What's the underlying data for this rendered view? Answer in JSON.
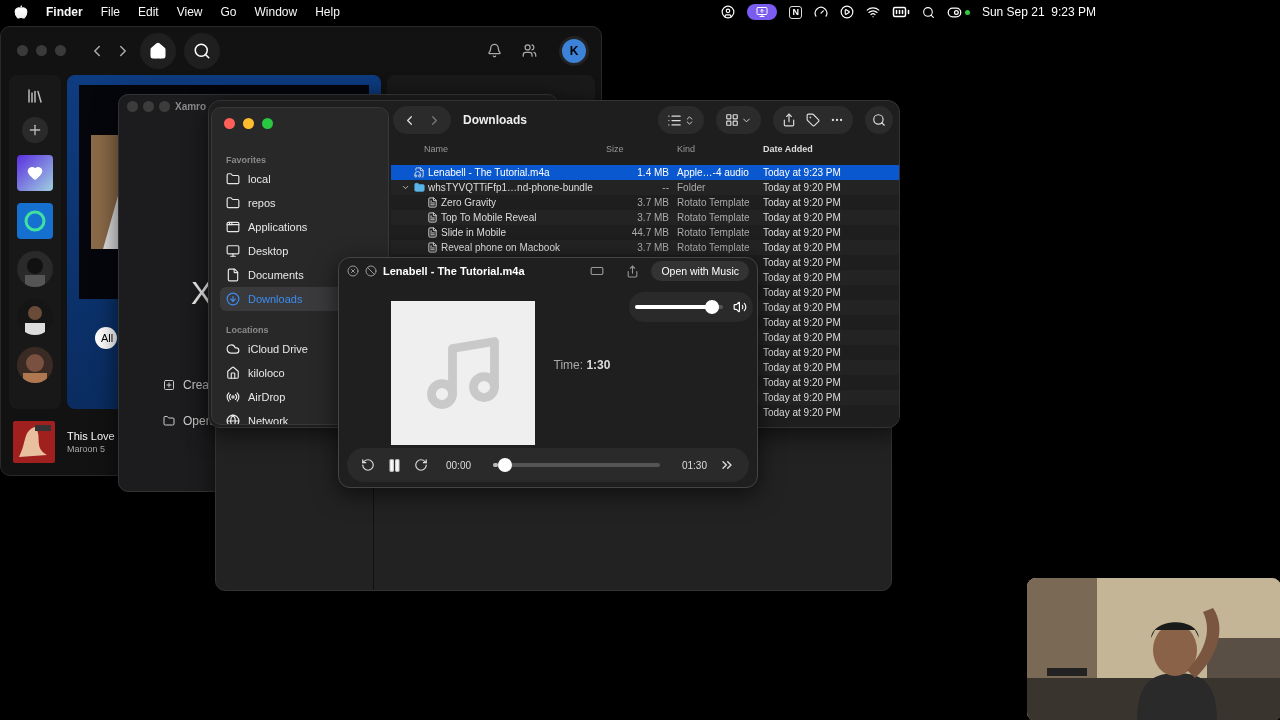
{
  "menu_bar": {
    "app": "Finder",
    "menus": [
      "File",
      "Edit",
      "View",
      "Go",
      "Window",
      "Help"
    ],
    "status_badge": "N",
    "clock": "Sun Sep 21  9:23 PM"
  },
  "music_app": {
    "avatar": "K",
    "filter_chip": "All",
    "now_playing": {
      "title": "This Love",
      "artist": "Maroon 5"
    }
  },
  "xamrock_window": {
    "title": "Xamro",
    "logo_letter": "X",
    "actions": [
      {
        "kind": "create",
        "label": "Crea"
      },
      {
        "kind": "open",
        "label": "Open"
      }
    ]
  },
  "finder": {
    "title": "Downloads",
    "sidebar": [
      {
        "heading": "Favorites",
        "items": [
          {
            "kind": "folder",
            "label": "local",
            "selected": false
          },
          {
            "kind": "folder",
            "label": "repos",
            "selected": false
          },
          {
            "kind": "apps",
            "label": "Applications",
            "selected": false
          },
          {
            "kind": "desktop",
            "label": "Desktop",
            "selected": false
          },
          {
            "kind": "document",
            "label": "Documents",
            "selected": false
          },
          {
            "kind": "download",
            "label": "Downloads",
            "selected": true
          }
        ]
      },
      {
        "heading": "Locations",
        "items": [
          {
            "kind": "cloud",
            "label": "iCloud Drive",
            "selected": false
          },
          {
            "kind": "home",
            "label": "kiloloco",
            "selected": false
          },
          {
            "kind": "airdrop",
            "label": "AirDrop",
            "selected": false
          },
          {
            "kind": "network",
            "label": "Network",
            "selected": false
          }
        ]
      }
    ],
    "columns": [
      {
        "label": "Name",
        "sorted": false
      },
      {
        "label": "Size",
        "sorted": false
      },
      {
        "label": "Kind",
        "sorted": false
      },
      {
        "label": "Date Added",
        "sorted": true
      }
    ],
    "rows": [
      {
        "kind": "audio",
        "name": "Lenabell - The Tutorial.m4a",
        "size": "1.4 MB",
        "type": "Apple…-4 audio",
        "date": "Today at 9:23 PM",
        "selected": true
      },
      {
        "kind": "folder",
        "name": "whsTYVQTTiFfp1…nd-phone-bundle",
        "size": "--",
        "type": "Folder",
        "date": "Today at 9:20 PM",
        "selected": false,
        "expanded": true,
        "children": [
          {
            "kind": "document",
            "name": "Zero Gravity",
            "size": "3.7 MB",
            "type": "Rotato Template",
            "date": "Today at 9:20 PM",
            "selected": false
          },
          {
            "kind": "document",
            "name": "Top To Mobile Reveal",
            "size": "3.7 MB",
            "type": "Rotato Template",
            "date": "Today at 9:20 PM",
            "selected": false
          },
          {
            "kind": "document",
            "name": "Slide in Mobile",
            "size": "44.7 MB",
            "type": "Rotato Template",
            "date": "Today at 9:20 PM",
            "selected": false
          },
          {
            "kind": "document",
            "name": "Reveal phone on Macbook",
            "size": "3.7 MB",
            "type": "Rotato Template",
            "date": "Today at 9:20 PM",
            "selected": false
          },
          {
            "date": "Today at 9:20 PM",
            "selected": false
          },
          {
            "date": "Today at 9:20 PM",
            "selected": false
          },
          {
            "date": "Today at 9:20 PM",
            "selected": false
          },
          {
            "date": "Today at 9:20 PM",
            "selected": false
          },
          {
            "date": "Today at 9:20 PM",
            "selected": false
          },
          {
            "date": "Today at 9:20 PM",
            "selected": false
          },
          {
            "date": "Today at 9:20 PM",
            "selected": false
          },
          {
            "date": "Today at 9:20 PM",
            "selected": false
          },
          {
            "date": "Today at 9:20 PM",
            "selected": false
          },
          {
            "date": "Today at 9:20 PM",
            "selected": false
          },
          {
            "date": "Today at 9:20 PM",
            "selected": false
          }
        ]
      }
    ]
  },
  "quick_look": {
    "title": "Lenabell - The Tutorial.m4a",
    "open_button": "Open with Music",
    "volume": {
      "level": 0.95
    },
    "time": "Time: **1:30**",
    "playing": true,
    "elapsed": "00:00",
    "progress": {
      "level": 0.03
    },
    "duration": "01:30"
  }
}
